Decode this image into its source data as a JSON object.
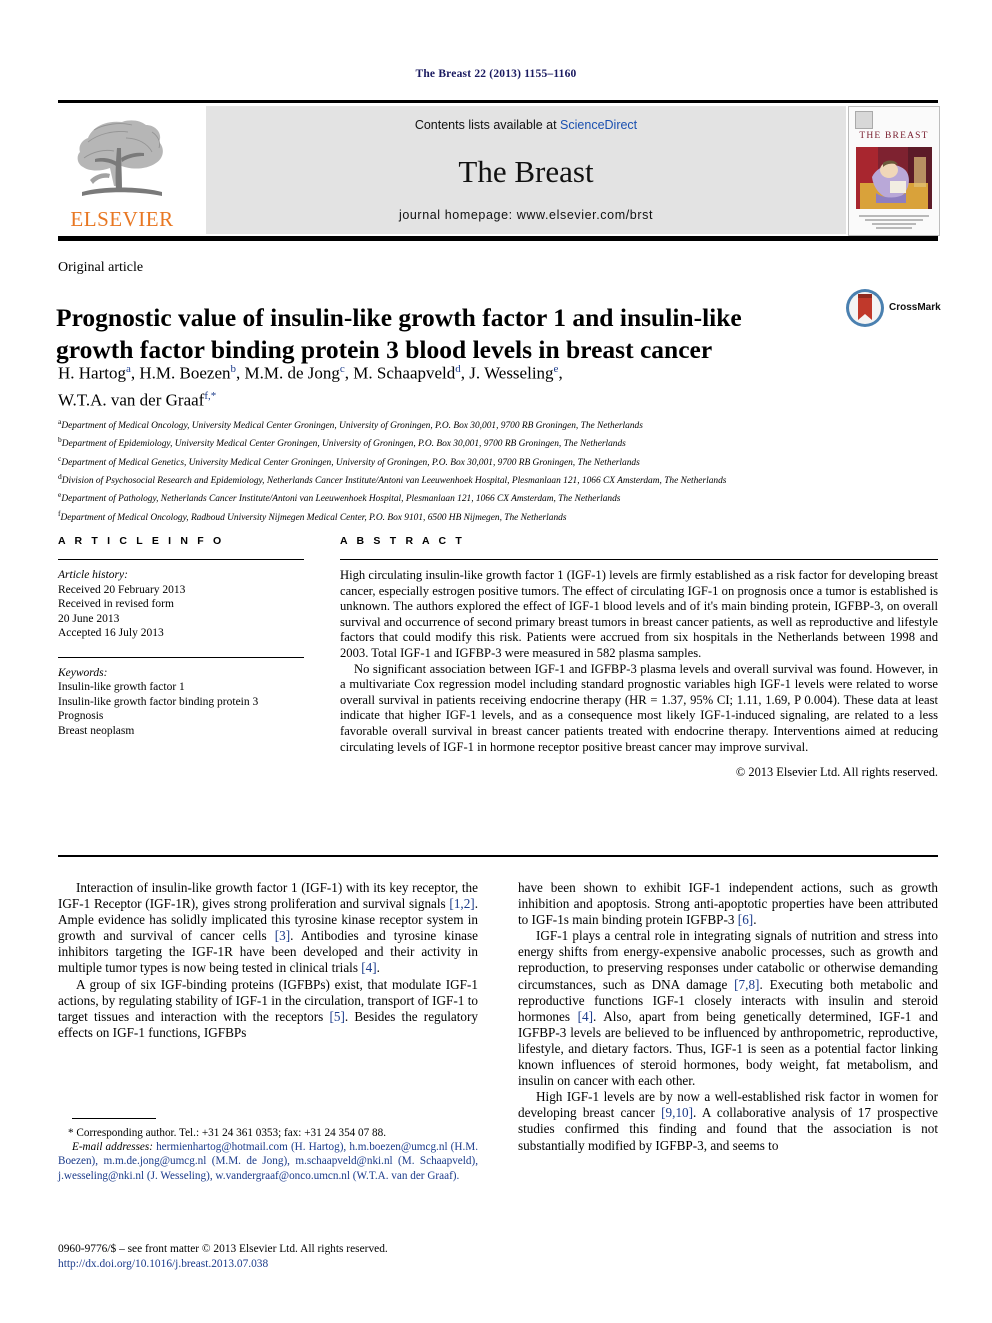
{
  "running_head": "The Breast 22 (2013) 1155–1160",
  "masthead": {
    "publisher": "ELSEVIER",
    "contents_prefix": "Contents lists available at ",
    "contents_link": "ScienceDirect",
    "journal_name": "The Breast",
    "homepage": "journal homepage: www.elsevier.com/brst",
    "cover_title": "THE BREAST"
  },
  "article": {
    "type": "Original article",
    "title": "Prognostic value of insulin-like growth factor 1 and insulin-like growth factor binding protein 3 blood levels in breast cancer",
    "crossmark_label": "CrossMark",
    "authors": "H. Hartog a, H.M. Boezen b, M.M. de Jong c, M. Schaapveld d, J. Wesseling e, W.T.A. van der Graaf f,*",
    "affiliations": [
      "a Department of Medical Oncology, University Medical Center Groningen, University of Groningen, P.O. Box 30,001, 9700 RB Groningen, The Netherlands",
      "b Department of Epidemiology, University Medical Center Groningen, University of Groningen, P.O. Box 30,001, 9700 RB Groningen, The Netherlands",
      "c Department of Medical Genetics, University Medical Center Groningen, University of Groningen, P.O. Box 30,001, 9700 RB Groningen, The Netherlands",
      "d Division of Psychosocial Research and Epidemiology, Netherlands Cancer Institute/Antoni van Leeuwenhoek Hospital, Plesmanlaan 121, 1066 CX Amsterdam, The Netherlands",
      "e Department of Pathology, Netherlands Cancer Institute/Antoni van Leeuwenhoek Hospital, Plesmanlaan 121, 1066 CX Amsterdam, The Netherlands",
      "f Department of Medical Oncology, Radboud University Nijmegen Medical Center, P.O. Box 9101, 6500 HB Nijmegen, The Netherlands"
    ]
  },
  "article_info": {
    "heading": "A R T I C L E  I N F O",
    "history_label": "Article history:",
    "history": [
      "Received 20 February 2013",
      "Received in revised form",
      "20 June 2013",
      "Accepted 16 July 2013"
    ],
    "keywords_label": "Keywords:",
    "keywords": [
      "Insulin-like growth factor 1",
      "Insulin-like growth factor binding protein 3",
      "Prognosis",
      "Breast neoplasm"
    ]
  },
  "abstract": {
    "heading": "A B S T R A C T",
    "paragraphs": [
      "High circulating insulin-like growth factor 1 (IGF-1) levels are firmly established as a risk factor for developing breast cancer, especially estrogen positive tumors. The effect of circulating IGF-1 on prognosis once a tumor is established is unknown. The authors explored the effect of IGF-1 blood levels and of it's main binding protein, IGFBP-3, on overall survival and occurrence of second primary breast tumors in breast cancer patients, as well as reproductive and lifestyle factors that could modify this risk. Patients were accrued from six hospitals in the Netherlands between 1998 and 2003. Total IGF-1 and IGFBP-3 were measured in 582 plasma samples.",
      "No significant association between IGF-1 and IGFBP-3 plasma levels and overall survival was found. However, in a multivariate Cox regression model including standard prognostic variables high IGF-1 levels were related to worse overall survival in patients receiving endocrine therapy (HR = 1.37, 95% CI; 1.11, 1.69, P 0.004). These data at least indicate that higher IGF-1 levels, and as a consequence most likely IGF-1-induced signaling, are related to a less favorable overall survival in breast cancer patients treated with endocrine therapy. Interventions aimed at reducing circulating levels of IGF-1 in hormone receptor positive breast cancer may improve survival."
    ],
    "copyright": "© 2013 Elsevier Ltd. All rights reserved."
  },
  "body": {
    "left_paragraphs": [
      "Interaction of insulin-like growth factor 1 (IGF-1) with its key receptor, the IGF-1 Receptor (IGF-1R), gives strong proliferation and survival signals [1,2]. Ample evidence has solidly implicated this tyrosine kinase receptor system in growth and survival of cancer cells [3]. Antibodies and tyrosine kinase inhibitors targeting the IGF-1R have been developed and their activity in multiple tumor types is now being tested in clinical trials [4].",
      "A group of six IGF-binding proteins (IGFBPs) exist, that modulate IGF-1 actions, by regulating stability of IGF-1 in the circulation, transport of IGF-1 to target tissues and interaction with the receptors [5]. Besides the regulatory effects on IGF-1 functions, IGFBPs"
    ],
    "right_paragraphs": [
      "have been shown to exhibit IGF-1 independent actions, such as growth inhibition and apoptosis. Strong anti-apoptotic properties have been attributed to IGF-1s main binding protein IGFBP-3 [6].",
      "IGF-1 plays a central role in integrating signals of nutrition and stress into energy shifts from energy-expensive anabolic processes, such as growth and reproduction, to preserving responses under catabolic or otherwise demanding circumstances, such as DNA damage [7,8]. Executing both metabolic and reproductive functions IGF-1 closely interacts with insulin and steroid hormones [4]. Also, apart from being genetically determined, IGF-1 and IGFBP-3 levels are believed to be influenced by anthropometric, reproductive, lifestyle, and dietary factors. Thus, IGF-1 is seen as a potential factor linking known influences of steroid hormones, body weight, fat metabolism, and insulin on cancer with each other.",
      "High IGF-1 levels are by now a well-established risk factor in women for developing breast cancer [9,10]. A collaborative analysis of 17 prospective studies confirmed this finding and found that the association is not substantially modified by IGFBP-3, and seems to"
    ]
  },
  "footnote": {
    "corresponding": "* Corresponding author. Tel.: +31 24 361 0353; fax: +31 24 354 07 88.",
    "email_label": "E-mail addresses:",
    "emails": "hermienhartog@hotmail.com (H. Hartog), h.m.boezen@umcg.nl (H.M. Boezen), m.m.de.jong@umcg.nl (M.M. de Jong), m.schaapveld@nki.nl (M. Schaapveld), j.wesseling@nki.nl (J. Wesseling), w.vandergraaf@onco.umcn.nl (W.T.A. van der Graaf)."
  },
  "imprint": {
    "issn_line": "0960-9776/$ – see front matter © 2013 Elsevier Ltd. All rights reserved.",
    "doi": "http://dx.doi.org/10.1016/j.breast.2013.07.038"
  }
}
